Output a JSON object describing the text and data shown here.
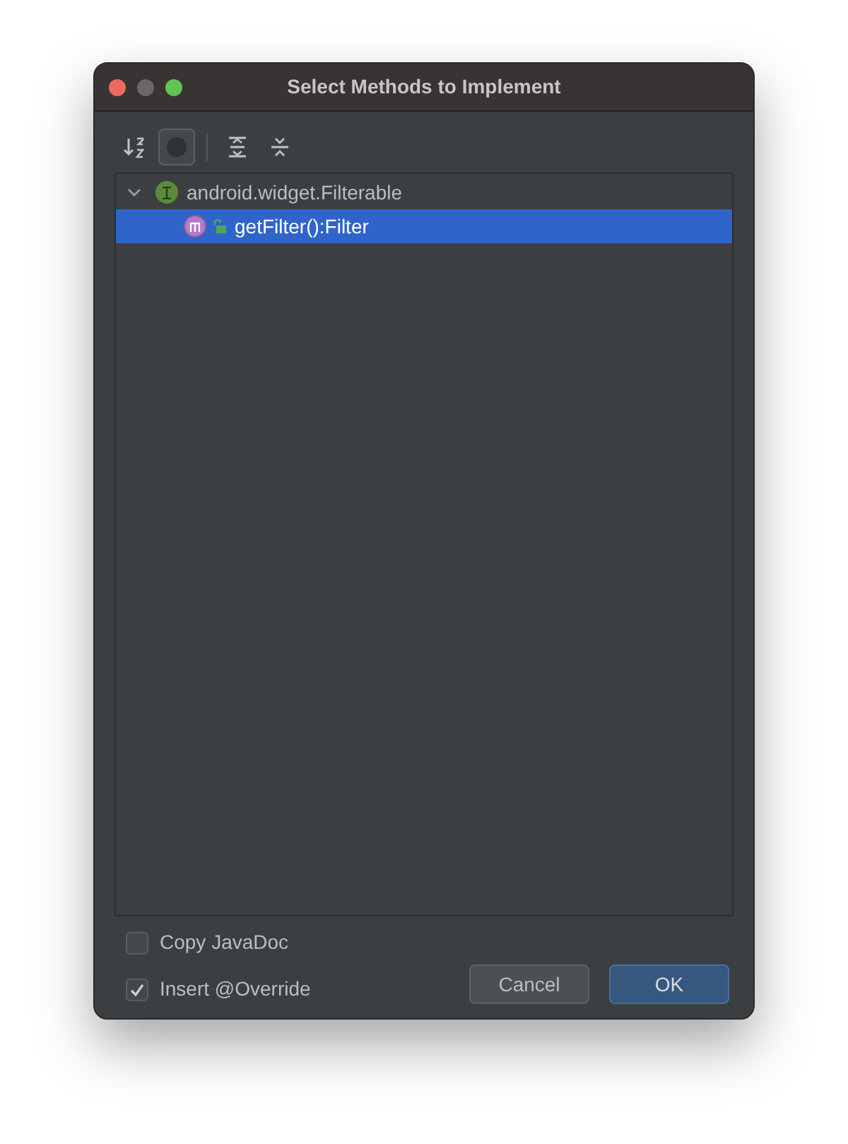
{
  "window": {
    "title": "Select Methods to Implement"
  },
  "toolbar": [
    {
      "kind": "sort",
      "selected": false
    },
    {
      "kind": "toggle",
      "selected": true
    },
    {
      "kind": "expand",
      "selected": false
    },
    {
      "kind": "collapse",
      "selected": false
    }
  ],
  "tree": [
    {
      "label": "android.widget.Filterable",
      "kind": "interface",
      "expanded": true,
      "selected": false,
      "children": [
        {
          "label": "getFilter():Filter",
          "kind": "method",
          "selected": true
        }
      ]
    }
  ],
  "options": [
    {
      "label": "Copy JavaDoc",
      "checked": false
    },
    {
      "label": "Insert @Override",
      "checked": true
    }
  ],
  "buttons": [
    {
      "label": "Cancel",
      "kind": "default"
    },
    {
      "label": "OK",
      "kind": "primary"
    }
  ]
}
